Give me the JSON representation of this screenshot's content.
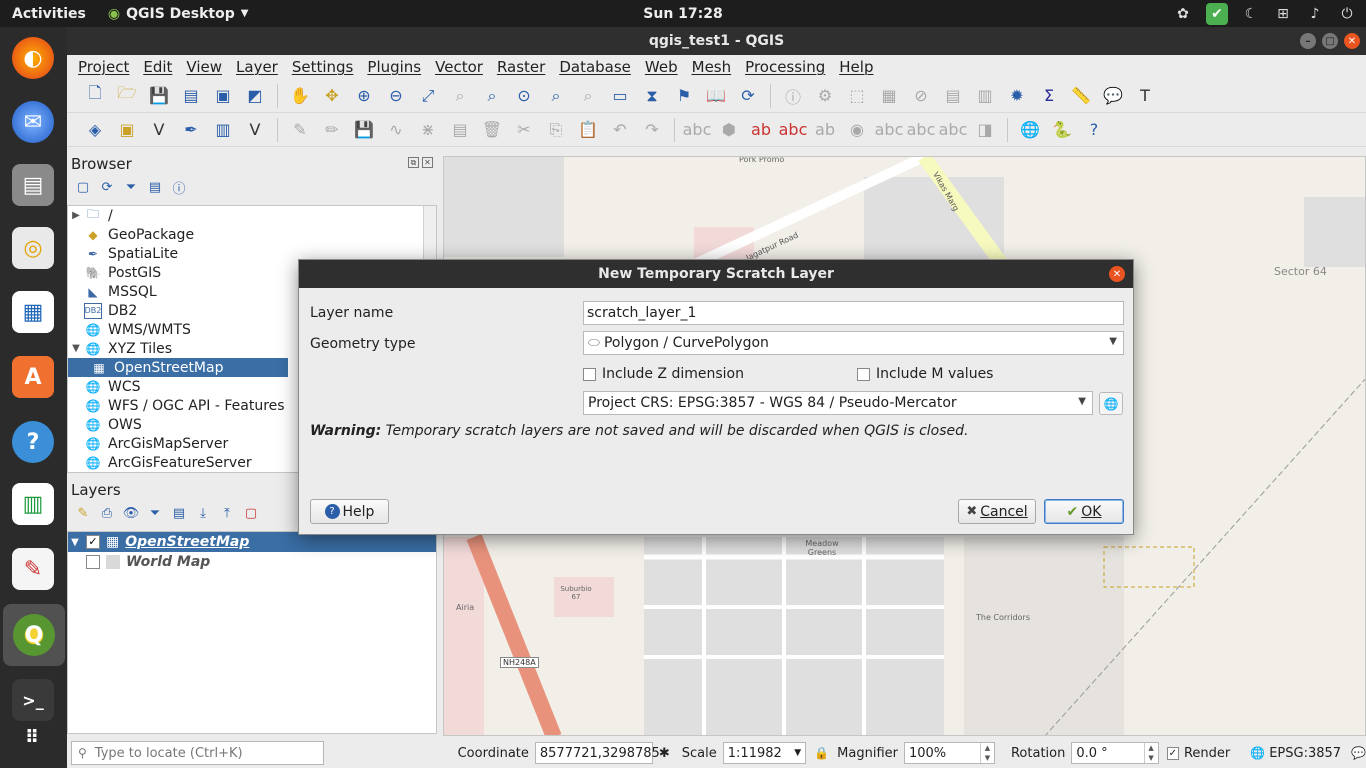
{
  "topbar": {
    "activities": "Activities",
    "app_name": "QGIS Desktop",
    "clock": "Sun 17:28"
  },
  "window": {
    "title": "qgis_test1 - QGIS"
  },
  "menubar": [
    "Project",
    "Edit",
    "View",
    "Layer",
    "Settings",
    "Plugins",
    "Vector",
    "Raster",
    "Database",
    "Web",
    "Mesh",
    "Processing",
    "Help"
  ],
  "browser": {
    "title": "Browser",
    "items": [
      {
        "label": "/",
        "icon": "folder-icon",
        "arrow": "▶"
      },
      {
        "label": "GeoPackage",
        "icon": "geopackage-icon",
        "arrow": ""
      },
      {
        "label": "SpatiaLite",
        "icon": "spatialite-icon",
        "arrow": ""
      },
      {
        "label": "PostGIS",
        "icon": "postgis-icon",
        "arrow": ""
      },
      {
        "label": "MSSQL",
        "icon": "mssql-icon",
        "arrow": ""
      },
      {
        "label": "DB2",
        "icon": "db2-icon",
        "arrow": ""
      },
      {
        "label": "WMS/WMTS",
        "icon": "globe-icon",
        "arrow": ""
      },
      {
        "label": "XYZ Tiles",
        "icon": "globe-icon",
        "arrow": "▼"
      },
      {
        "label": "OpenStreetMap",
        "icon": "xyz-tile-icon",
        "arrow": ""
      },
      {
        "label": "WCS",
        "icon": "globe-icon",
        "arrow": ""
      },
      {
        "label": "WFS / OGC API - Features",
        "icon": "globe-icon",
        "arrow": ""
      },
      {
        "label": "OWS",
        "icon": "globe-icon",
        "arrow": ""
      },
      {
        "label": "ArcGisMapServer",
        "icon": "globe-icon",
        "arrow": ""
      },
      {
        "label": "ArcGisFeatureServer",
        "icon": "globe-icon",
        "arrow": ""
      }
    ]
  },
  "layers": {
    "title": "Layers",
    "items": [
      {
        "label": "OpenStreetMap",
        "checked": "✓"
      },
      {
        "label": "World Map",
        "checked": ""
      }
    ]
  },
  "map_labels": {
    "pork_promo": "Pork Promo",
    "vikas_marg": "Vikas Marg",
    "road": "Jagatpur Road",
    "sector": "Sector 64",
    "meadow": "Meadow Greens",
    "suburbio": "Suburbio 67",
    "airia": "Airia",
    "corridors": "The Corridors",
    "highway": "NH248A"
  },
  "dialog": {
    "title": "New Temporary Scratch Layer",
    "layer_name_label": "Layer name",
    "layer_name_value": "scratch_layer_1",
    "geometry_type_label": "Geometry type",
    "geometry_type_value": "Polygon / CurvePolygon",
    "include_z": "Include Z dimension",
    "include_m": "Include M values",
    "crs_value": "Project CRS: EPSG:3857 - WGS 84 / Pseudo-Mercator",
    "warning_bold": "Warning:",
    "warning_text": " Temporary scratch layers are not saved and will be discarded when QGIS is closed.",
    "help_button": "Help",
    "cancel_button": "Cancel",
    "ok_button": "OK"
  },
  "statusbar": {
    "locator_placeholder": "Type to locate (Ctrl+K)",
    "coordinate_label": "Coordinate",
    "coordinate_value": "8577721,3298785",
    "scale_label": "Scale",
    "scale_value": "1:11982",
    "magnifier_label": "Magnifier",
    "magnifier_value": "100%",
    "rotation_label": "Rotation",
    "rotation_value": "0.0 °",
    "render_label": "Render",
    "crs_label": "EPSG:3857"
  },
  "colors": {
    "selection": "#3a6ea5",
    "accent_close": "#e95420",
    "map_background": "#f2efe9",
    "highway": "#e8927c"
  }
}
